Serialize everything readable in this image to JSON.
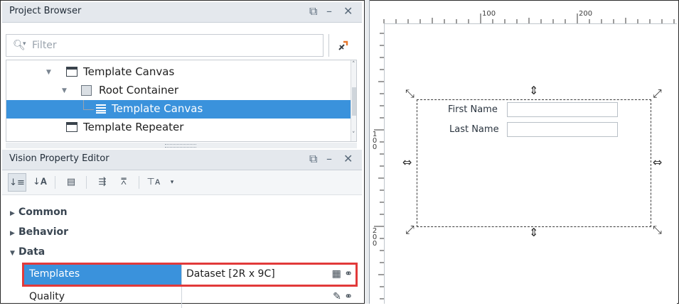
{
  "project_browser": {
    "title": "Project Browser",
    "filter_placeholder": "Filter",
    "tree": [
      {
        "label": "Template Canvas",
        "icon": "template-canvas-icon",
        "expanded": true
      },
      {
        "label": "Root Container",
        "icon": "root-container-icon",
        "expanded": true
      },
      {
        "label": "Template Canvas",
        "icon": "template-canvas-list-icon",
        "selected": true
      },
      {
        "label": "Template Repeater",
        "icon": "template-canvas-icon"
      }
    ]
  },
  "property_editor": {
    "title": "Vision Property Editor",
    "groups": [
      "Common",
      "Behavior",
      "Data"
    ],
    "properties": [
      {
        "name": "Templates",
        "value": "Dataset [2R x 9C]",
        "highlighted": true
      },
      {
        "name": "Quality",
        "value": ""
      }
    ]
  },
  "designer": {
    "ruler_h_labels": [
      "100",
      "200"
    ],
    "ruler_v_labels": [
      "100",
      "200"
    ],
    "form": {
      "first_name_label": "First Name",
      "last_name_label": "Last Name"
    }
  },
  "colors": {
    "selection": "#3a92dc",
    "highlight_border": "#e23a3a",
    "panel_header": "#e4e8ed"
  }
}
